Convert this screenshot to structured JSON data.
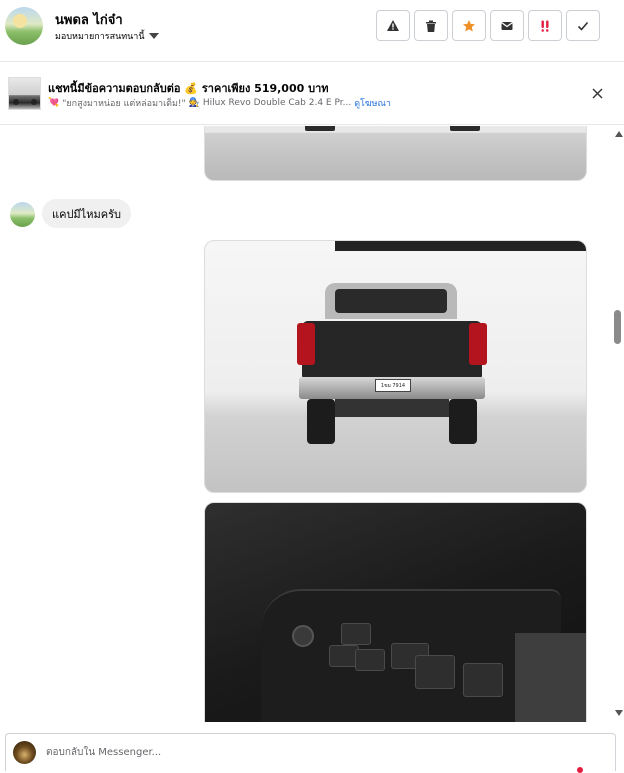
{
  "header": {
    "contact_name": "นพดล ไก่จ๋า",
    "assign_label": "มอบหมายการสนทนานี้",
    "actions": [
      {
        "name": "report-icon",
        "label": "!"
      },
      {
        "name": "trash-icon",
        "label": ""
      },
      {
        "name": "star-icon",
        "label": "★"
      },
      {
        "name": "mail-icon",
        "label": ""
      },
      {
        "name": "spam-icon",
        "label": "!!"
      },
      {
        "name": "check-icon",
        "label": "✓"
      }
    ],
    "star_color": "#f08f26",
    "spam_color": "#e41e3f"
  },
  "ad": {
    "title": "แชทนี้มีข้อความตอบกลับต่อ 💰 ราคาเพียง 519,000 บาท",
    "subtitle": "\"ยกสูงมาหน่อย แต่หล่อมาเต็ม!\"",
    "vehicle": "Hilux Revo Double Cab 2.4 E Pr...",
    "link": "ดูโฆษณา",
    "link_color": "#216fdb"
  },
  "chat": {
    "customer_message": "แคปมีไหมครับ",
    "plate_text": "1ขม 7914"
  },
  "reply": {
    "placeholder": "ตอบกลับใน Messenger..."
  }
}
